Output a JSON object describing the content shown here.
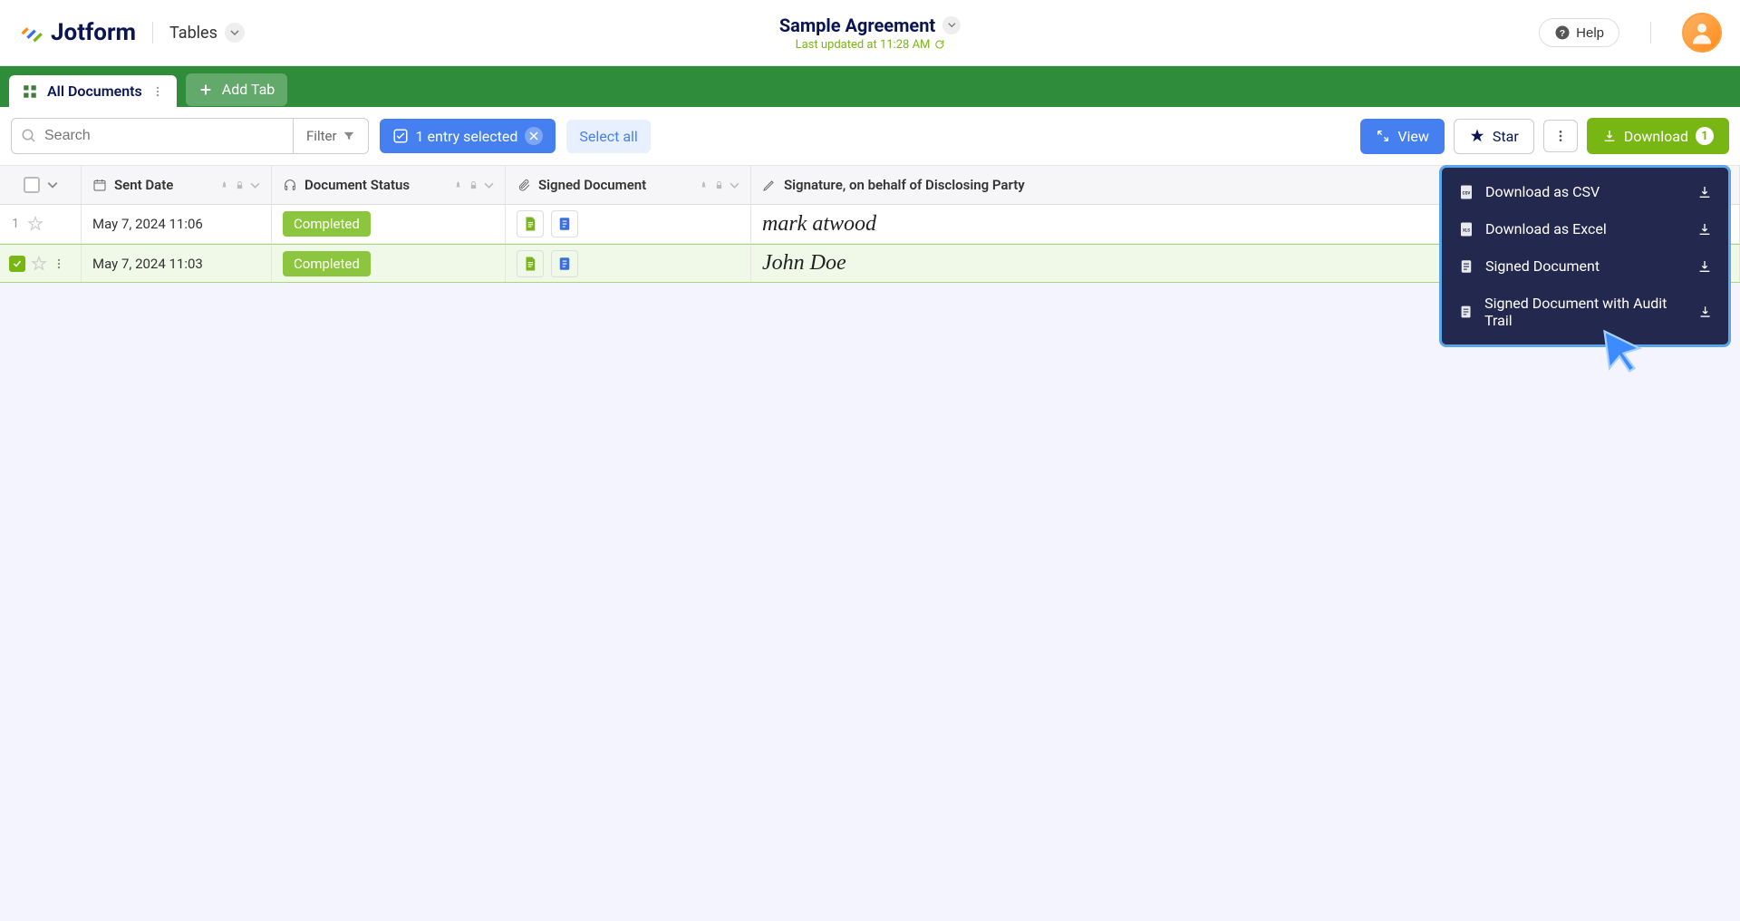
{
  "brand": "Jotform",
  "nav": {
    "tables": "Tables"
  },
  "document": {
    "title": "Sample Agreement",
    "last_updated": "Last updated at 11:28 AM"
  },
  "header": {
    "help": "Help"
  },
  "tabs": {
    "active": "All Documents",
    "add": "Add Tab"
  },
  "toolbar": {
    "search_placeholder": "Search",
    "filter": "Filter",
    "selected": "1 entry selected",
    "select_all": "Select all",
    "view": "View",
    "star": "Star",
    "download": "Download",
    "download_count": "1"
  },
  "columns": {
    "sent_date": "Sent Date",
    "status": "Document Status",
    "signed_doc": "Signed Document",
    "signature": "Signature, on behalf of Disclosing Party"
  },
  "rows": [
    {
      "num": "1",
      "checked": false,
      "date": "May 7, 2024 11:06",
      "status": "Completed",
      "signature": "mark atwood"
    },
    {
      "num": "",
      "checked": true,
      "date": "May 7, 2024 11:03",
      "status": "Completed",
      "signature": "John Doe"
    }
  ],
  "dropdown": {
    "csv": "Download as CSV",
    "excel": "Download as Excel",
    "signed": "Signed Document",
    "audit": "Signed Document with Audit Trail"
  }
}
